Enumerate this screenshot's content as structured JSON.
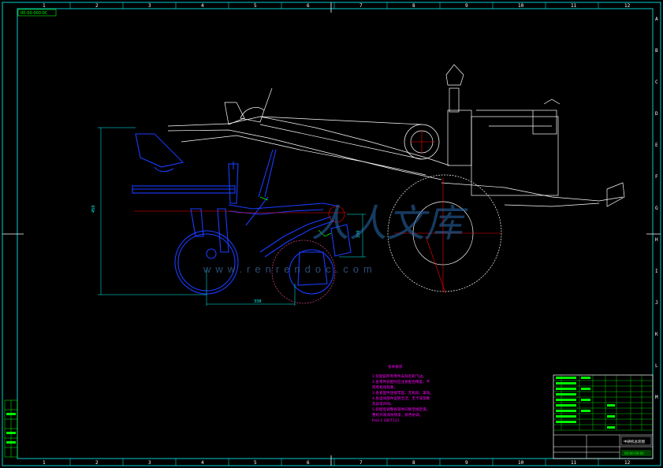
{
  "drawing": {
    "id_tag": "00-00-000-0C",
    "watermark_text": "人人文库",
    "watermark_url": "www.renrendoc.com",
    "zone_columns": [
      "1",
      "2",
      "3",
      "4",
      "5",
      "6",
      "7",
      "8",
      "9",
      "10",
      "11",
      "12"
    ],
    "zone_rows": [
      "A",
      "B",
      "C",
      "D",
      "E",
      "F",
      "G",
      "H",
      "I",
      "J",
      "K",
      "L",
      "M"
    ],
    "dimensions": {
      "height_left": "450",
      "depth_right": "330",
      "bottom_width": "338"
    },
    "notes": {
      "title": "技术要求",
      "lines": [
        "1.装配前所有零件去除毛刺飞边。",
        "2.各零件装配时应注意配合精度，不",
        "  得有松动现象。",
        "3.各紧固件连接牢固，无松动、窜动。",
        "4.各运动部件运转灵活，无卡滞现象",
        "  及异常声响。",
        "5.装配后调整各部件间隙至规定值。",
        "  整机外观涂防锈漆，颜色协调。",
        "  Ra3.2 GB/T131"
      ]
    },
    "title_block": {
      "title": "中耕机总装图",
      "drawing_no": "00-00-00-00"
    }
  }
}
